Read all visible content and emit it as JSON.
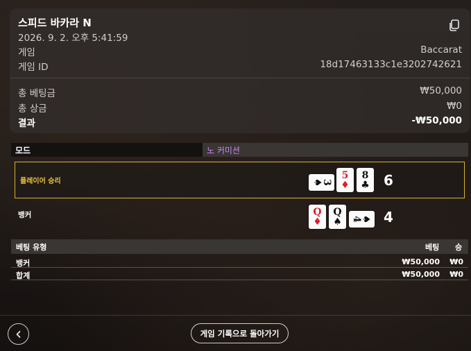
{
  "header": {
    "title": "스피드 바카라 N",
    "datetime": "2026. 9. 2. 오후 5:41:59",
    "copy_icon": "copy-icon"
  },
  "info": {
    "game_label": "게임",
    "game_value": "Baccarat",
    "game_id_label": "게임 ID",
    "game_id_value": "18d17463133c1e3202742621"
  },
  "totals": {
    "total_bet_label": "총 베팅금",
    "total_bet_value": "₩50,000",
    "total_win_label": "총 상금",
    "total_win_value": "₩0",
    "result_label": "결과",
    "result_value": "-₩50,000"
  },
  "mode": {
    "label": "모드",
    "value": "노 커미션"
  },
  "hands": {
    "player": {
      "label": "플레이어 승리",
      "score": "6",
      "cards": [
        {
          "rank": "3",
          "suit": "♠",
          "orientation": "horizontal"
        },
        {
          "rank": "5",
          "suit": "♦",
          "orientation": "vertical"
        },
        {
          "rank": "8",
          "suit": "♣",
          "orientation": "vertical"
        }
      ]
    },
    "banker": {
      "label": "뱅커",
      "score": "4",
      "cards": [
        {
          "rank": "Q",
          "suit": "♦",
          "orientation": "vertical"
        },
        {
          "rank": "Q",
          "suit": "♠",
          "orientation": "vertical"
        },
        {
          "rank": "4",
          "suit": "♠",
          "orientation": "horizontal"
        }
      ]
    }
  },
  "bets": {
    "columns": [
      "베팅 유형",
      "베팅",
      "승"
    ],
    "rows": [
      {
        "type": "뱅커",
        "bet": "₩50,000",
        "win": "₩0"
      },
      {
        "type": "합계",
        "bet": "₩50,000",
        "win": "₩0"
      }
    ]
  },
  "footer": {
    "back_icon": "chevron-left-icon",
    "history_button": "게임 기록으로 돌아가기"
  },
  "colors": {
    "winner_border": "#d8b530",
    "winner_text": "#e8c23a",
    "mode_value": "#c98af0",
    "red_suit": "#d8202a"
  }
}
